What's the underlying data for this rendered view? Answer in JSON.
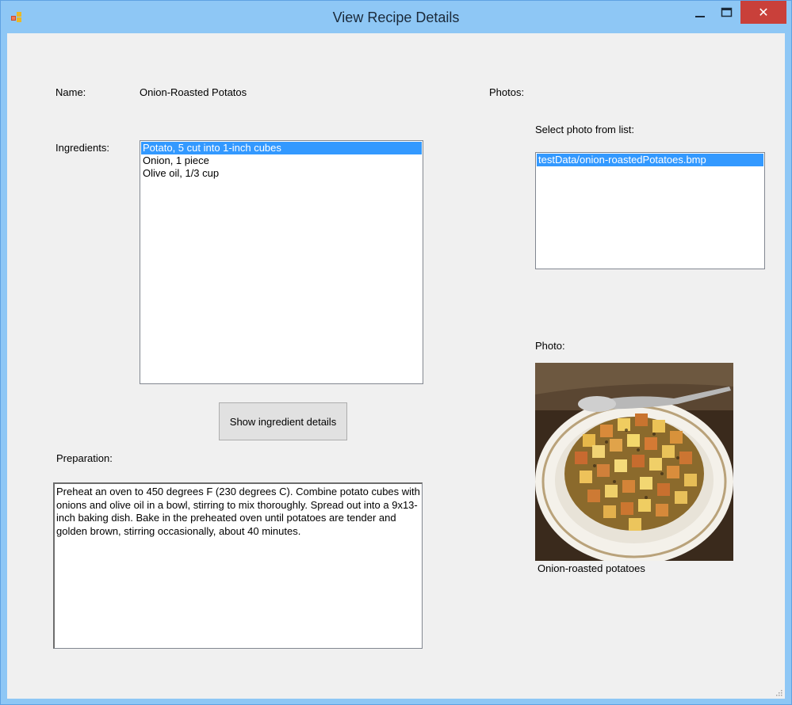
{
  "window": {
    "title": "View Recipe Details",
    "close_glyph": "✕"
  },
  "recipe": {
    "name_label": "Name:",
    "name_value": "Onion-Roasted Potatos",
    "ingredients_label": "Ingredients:",
    "ingredients": [
      "Potato, 5 cut into 1-inch cubes",
      "Onion, 1 piece",
      "Olive oil, 1/3 cup"
    ],
    "show_details_button": "Show ingredient details",
    "preparation_label": "Preparation:",
    "preparation_text": "Preheat an oven to 450 degrees F (230 degrees C). Combine potato cubes with onions and olive oil in a bowl, stirring to mix thoroughly. Spread out into a 9x13-inch baking dish. Bake in the preheated oven until potatoes are tender and golden brown, stirring occasionally, about 40 minutes."
  },
  "photos": {
    "photos_label": "Photos:",
    "select_label": "Select photo from list:",
    "files": [
      "testData/onion-roastedPotatoes.bmp"
    ],
    "photo_label": "Photo:",
    "caption": "Onion-roasted potatoes"
  },
  "colors": {
    "titlebar": "#8ec7f5",
    "close": "#c9403a",
    "selection": "#3399ff",
    "client": "#f0f0f0"
  }
}
